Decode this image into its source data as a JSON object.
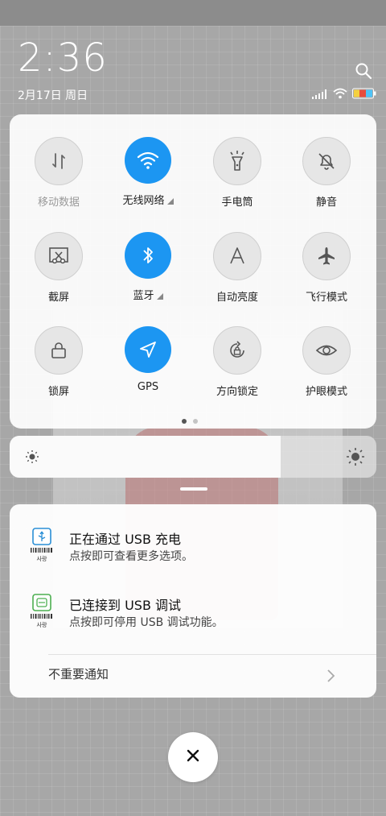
{
  "header": {
    "time": "2:36",
    "date": "2月17日 周日",
    "icons": [
      "search-icon",
      "signal-icon",
      "wifi-icon",
      "battery-icon"
    ]
  },
  "tiles": [
    {
      "label": "移动数据",
      "icon": "mobile-data-icon",
      "active": false,
      "disabled": true
    },
    {
      "label": "无线网络",
      "icon": "wifi-icon",
      "active": true,
      "has_more": true
    },
    {
      "label": "手电筒",
      "icon": "flashlight-icon",
      "active": false
    },
    {
      "label": "静音",
      "icon": "mute-bell-icon",
      "active": false
    },
    {
      "label": "截屏",
      "icon": "screenshot-icon",
      "active": false
    },
    {
      "label": "蓝牙",
      "icon": "bluetooth-icon",
      "active": true,
      "has_more": true
    },
    {
      "label": "自动亮度",
      "icon": "auto-brightness-icon",
      "active": false
    },
    {
      "label": "飞行模式",
      "icon": "airplane-icon",
      "active": false
    },
    {
      "label": "锁屏",
      "icon": "lock-icon",
      "active": false
    },
    {
      "label": "GPS",
      "icon": "gps-icon",
      "active": true
    },
    {
      "label": "方向锁定",
      "icon": "rotation-lock-icon",
      "active": false
    },
    {
      "label": "护眼模式",
      "icon": "eye-icon",
      "active": false
    }
  ],
  "pager": {
    "pages": 2,
    "current": 1
  },
  "brightness": {
    "level_percent": 74
  },
  "notifications": [
    {
      "title": "正在通过 USB 充电",
      "subtitle": "点按即可查看更多选项。",
      "icon": "usb-icon"
    },
    {
      "title": "已连接到 USB 调试",
      "subtitle": "点按即可停用 USB 调试功能。",
      "icon": "android-debug-icon"
    }
  ],
  "app_icon_text": "사랑",
  "minor_notifications": {
    "label": "不重要通知"
  },
  "colors": {
    "accent": "#1c96f2",
    "panel": "#ffffff"
  }
}
